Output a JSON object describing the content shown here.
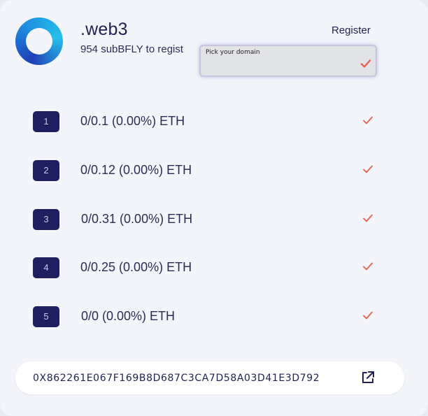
{
  "header": {
    "title": ".web3",
    "subtitle": "954 subBFLY to regist",
    "register_label": "Register"
  },
  "domain_picker": {
    "placeholder": "Pick your domain"
  },
  "tiers": [
    {
      "index": "1",
      "amount": "0/0.1 (0.00%) ETH"
    },
    {
      "index": "2",
      "amount": "0/0.12 (0.00%) ETH"
    },
    {
      "index": "3",
      "amount": "0/0.31 (0.00%) ETH"
    },
    {
      "index": "4",
      "amount": "0/0.25 (0.00%) ETH"
    },
    {
      "index": "5",
      "amount": "0/0 (0.00%) ETH"
    }
  ],
  "contract": {
    "address": "0X862261E067F169B8D687C3CA7D58A03D41E3D792"
  },
  "icons": {
    "logo": "ring-logo-icon",
    "check": "check-icon",
    "external": "external-link-icon"
  },
  "colors": {
    "accent_check": "#e8604a",
    "badge_bg": "#1e1f5e",
    "text_primary": "#1f2152"
  }
}
